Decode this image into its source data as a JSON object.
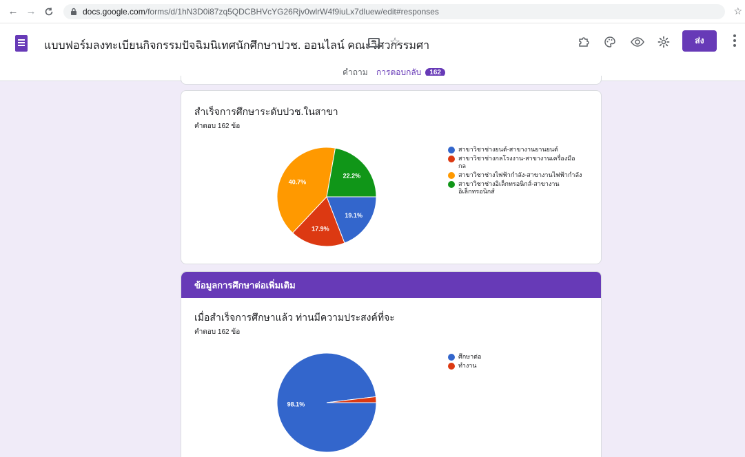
{
  "browser": {
    "url_domain": "docs.google.com",
    "url_path": "/forms/d/1hN3D0i87zq5QDCBHVcYG26Rjv0wlrW4f9iuLx7dluew/edit#responses"
  },
  "header": {
    "form_title": "แบบฟอร์มลงทะเบียนกิจกรรมปัจฉิมนิเทศนักศึกษาปวช. ออนไลน์ คณะวิศวกรรมศา",
    "send_label": "ส่ง",
    "tabs": [
      {
        "label": "คำถาม"
      },
      {
        "label": "การตอบกลับ",
        "badge": "162"
      }
    ]
  },
  "colors": {
    "accent": "#673ab7",
    "blue": "#3366cc",
    "red": "#dc3912",
    "orange": "#ff9900",
    "green": "#109618"
  },
  "questions": [
    {
      "title": "สำเร็จการศึกษาระดับปวช.ในสาขา",
      "count_text": "คำตอบ 162 ข้อ"
    },
    {
      "section_title": "ข้อมูลการศึกษาต่อเพิ่มเติม",
      "title": "เมื่อสำเร็จการศึกษาแล้ว ท่านมีความประสงค์ที่จะ",
      "count_text": "คำตอบ 162 ข้อ"
    }
  ],
  "chart_data": [
    {
      "type": "pie",
      "slices": [
        {
          "label": "สาขาวิชาช่างยนต์-สาขางานยานยนต์",
          "value": 19.1,
          "value_label": "19.1%",
          "color": "#3366cc"
        },
        {
          "label": "สาขาวิชาช่างกลโรงงาน-สาขางานเครื่องมือกล",
          "value": 17.9,
          "value_label": "17.9%",
          "color": "#dc3912"
        },
        {
          "label": "สาขาวิชาช่างไฟฟ้ากำลัง-สาขางานไฟฟ้ากำลัง",
          "value": 40.7,
          "value_label": "40.7%",
          "color": "#ff9900"
        },
        {
          "label": "สาขาวิชาช่างอิเล็กทรอนิกส์-สาขางานอิเล็กทรอนิกส์",
          "value": 22.2,
          "value_label": "22.2%",
          "color": "#109618"
        }
      ],
      "legend_position": "right"
    },
    {
      "type": "pie",
      "slices": [
        {
          "label": "ศึกษาต่อ",
          "value": 98.1,
          "value_label": "98.1%",
          "color": "#3366cc"
        },
        {
          "label": "ทำงาน",
          "value": 1.9,
          "value_label": "",
          "color": "#dc3912"
        }
      ],
      "legend_position": "right"
    }
  ]
}
